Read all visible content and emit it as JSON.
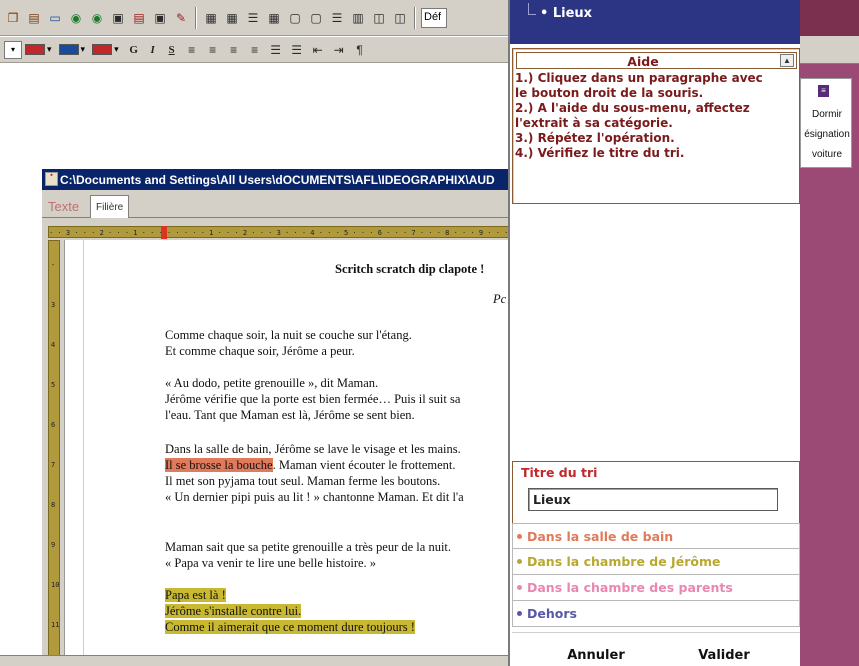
{
  "toolbar": {
    "style_value": "Déf"
  },
  "document": {
    "title": "C:\\Documents and Settings\\All Users\\dOCUMENTS\\AFL\\IDEOGRAPHIX\\AUD",
    "tabs": [
      {
        "label": "Texte"
      },
      {
        "label": "Filière"
      }
    ],
    "lines": [
      {
        "text": "Scritch scratch dip clapote !",
        "style": "title"
      },
      {
        "text": "Pc",
        "style": "author"
      },
      {
        "text": "Comme chaque soir, la nuit se couche sur l'étang.",
        "style": "normal"
      },
      {
        "text": "Et comme chaque soir, Jérôme a peur.",
        "style": "normal"
      },
      {
        "text": "« Au dodo, petite grenouille », dit Maman.",
        "style": "normal"
      },
      {
        "text": "Jérôme vérifie que la porte est bien fermée… Puis il suit sa",
        "style": "normal"
      },
      {
        "text": "l'eau. Tant que Maman est là, Jérôme se sent bien.",
        "style": "normal"
      },
      {
        "text": "Dans la salle de bain, Jérôme se lave le visage et les mains.",
        "style": "normal"
      },
      {
        "text_hl": "Il se brosse la bouche",
        "text_rest": ". Maman vient écouter le frottement.",
        "style": "hl-red"
      },
      {
        "text": "Il met son pyjama tout seul. Maman ferme les boutons.",
        "style": "normal"
      },
      {
        "text": "« Un dernier pipi puis au lit ! » chantonne Maman. Et dit l'a",
        "style": "normal"
      },
      {
        "text": "Maman sait que sa petite grenouille a très peur de la nuit.",
        "style": "normal"
      },
      {
        "text": "« Papa va venir te lire une belle histoire. »",
        "style": "normal"
      },
      {
        "text": "Papa est là !",
        "style": "hl-gold"
      },
      {
        "text": "Jérôme s'installe contre lui.",
        "style": "hl-gold"
      },
      {
        "text": "Comme il aimerait que ce moment dure toujours !",
        "style": "hl-gold"
      }
    ]
  },
  "panel": {
    "tree_item": "• Lieux",
    "aide": {
      "title": "Aide",
      "lines": [
        "1.) Cliquez dans un paragraphe avec",
        "le bouton droit de la souris.",
        "2.) A l'aide du sous-menu, affectez",
        "l'extrait à sa catégorie.",
        "3.) Répétez l'opération.",
        "4.) Vérifiez le titre du tri."
      ]
    },
    "tri": {
      "label": "Titre du tri",
      "value": "Lieux"
    },
    "categories": [
      {
        "label": "Dans la salle de bain",
        "color": "#e07a5a"
      },
      {
        "label": "Dans la chambre de Jérôme",
        "color": "#b8a830"
      },
      {
        "label": "Dans la chambre des parents",
        "color": "#e888b0"
      },
      {
        "label": "Dehors",
        "color": "#5858a8"
      }
    ],
    "buttons": {
      "cancel": "Annuler",
      "validate": "Valider"
    }
  },
  "right_menu": {
    "items": [
      "Dormir",
      "ésignation",
      "voiture"
    ]
  }
}
